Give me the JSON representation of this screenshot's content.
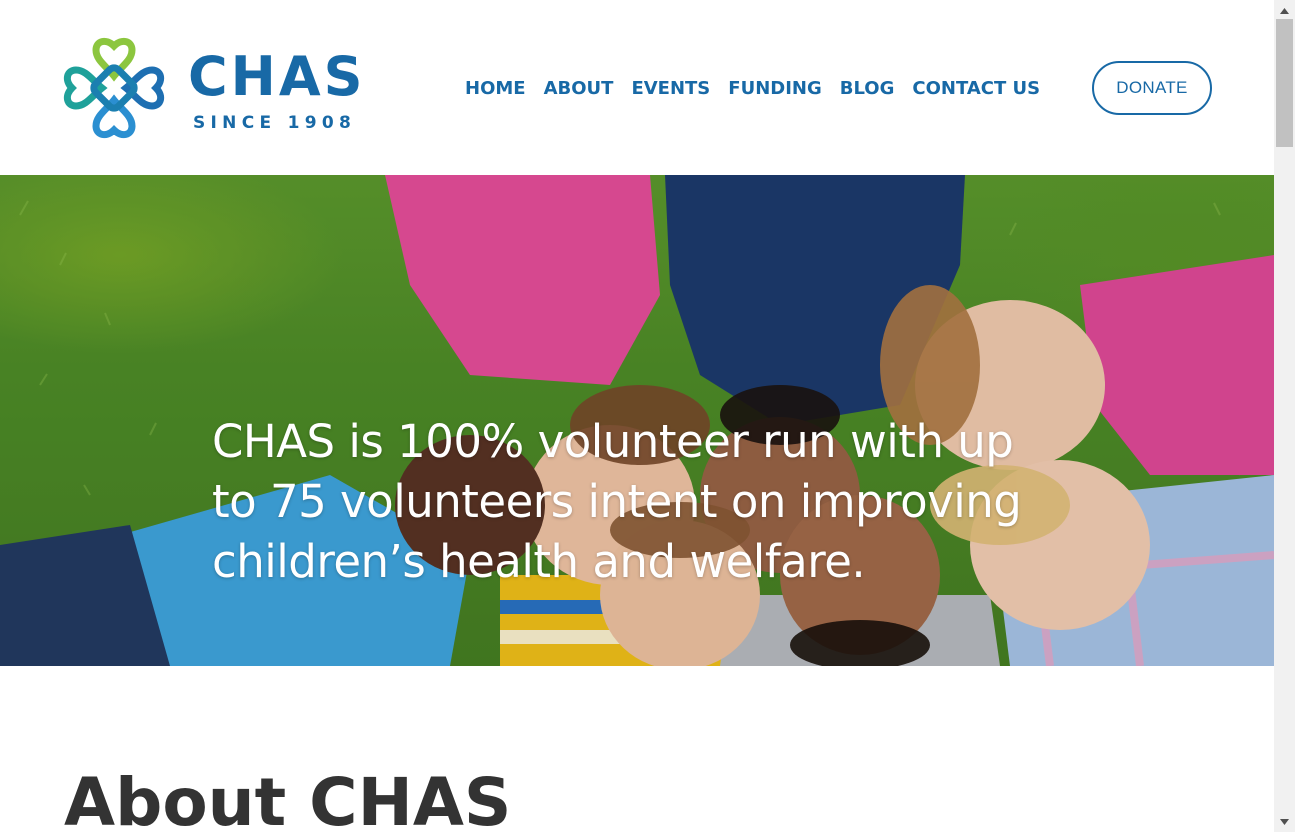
{
  "brand": {
    "name": "CHAS",
    "tagline": "SINCE 1908",
    "logo_icon": "heart-knot-logo-icon"
  },
  "nav": {
    "items": [
      {
        "label": "HOME"
      },
      {
        "label": "ABOUT"
      },
      {
        "label": "EVENTS"
      },
      {
        "label": "FUNDING"
      },
      {
        "label": "BLOG"
      },
      {
        "label": "CONTACT US"
      }
    ],
    "donate_label": "DONATE"
  },
  "hero": {
    "headline": "CHAS is 100% volunteer run with up to 75 volunteers intent on improving children’s health and welfare.",
    "image": "children-lying-on-grass-photo"
  },
  "about": {
    "title": "About CHAS"
  },
  "colors": {
    "brand_blue": "#1869a6",
    "brand_green": "#8cc63f",
    "brand_teal": "#1fa19a",
    "heading_dark": "#333333",
    "white": "#ffffff"
  }
}
